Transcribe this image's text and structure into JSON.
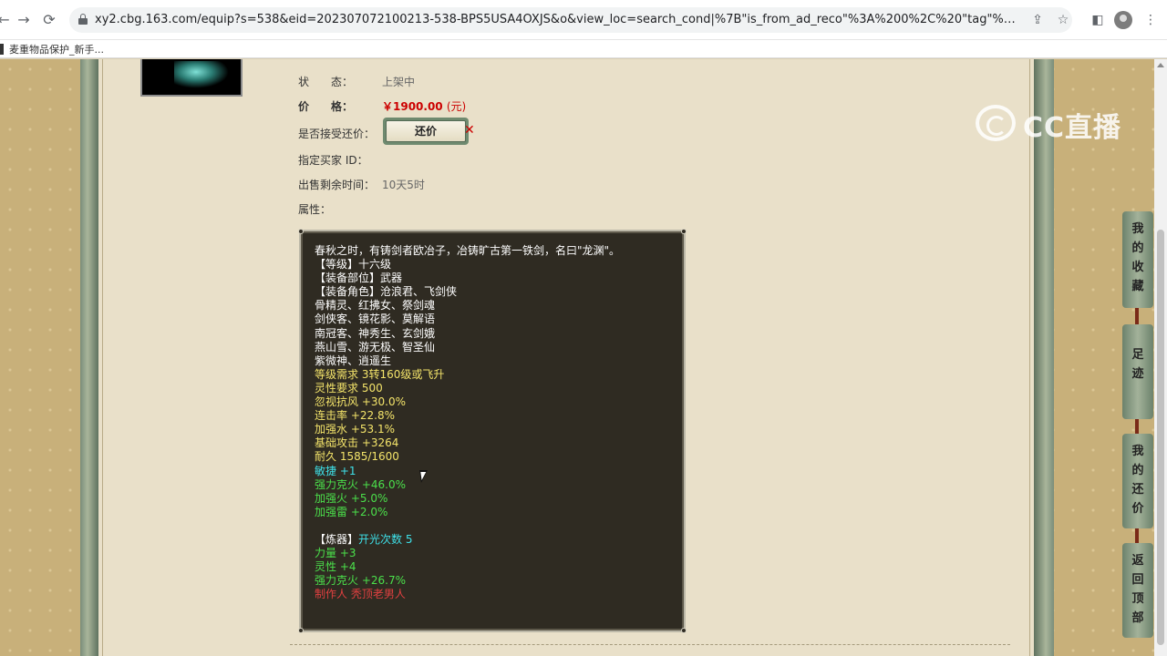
{
  "browser": {
    "url": "xy2.cbg.163.com/equip?s=538&eid=202307072100213-538-BPS5USA4OXJS&o&view_loc=search_cond|%7B\"is_from_ad_reco\"%3A%200%2C%20\"tag\"%3A%20\"user\"...",
    "bookmark_label": "麦重物品保护_新手..."
  },
  "item": {
    "status_label": "状　　态：",
    "status_value": "上架中",
    "price_label": "价　　格：",
    "price_value": "￥1900.00",
    "price_unit": "(元)",
    "counter_offer_label": "是否接受还价：",
    "counter_offer_button": "还价",
    "buyer_id_label": "指定买家 ID：",
    "remaining_label": "出售剩余时间：",
    "remaining_value": "10天5时",
    "attributes_label": "属性："
  },
  "attributes": {
    "lines": [
      {
        "text": "春秋之时，有铸剑者欧冶子，冶铸旷古第一铁剑，名曰\"龙渊\"。",
        "color": "white"
      },
      {
        "text": "【等级】十六级",
        "color": "white"
      },
      {
        "text": "【装备部位】武器",
        "color": "white"
      },
      {
        "text": "【装备角色】沧浪君、飞剑侠",
        "color": "white"
      },
      {
        "text": "骨精灵、红拂女、祭剑魂",
        "color": "white"
      },
      {
        "text": "剑侠客、镜花影、莫解语",
        "color": "white"
      },
      {
        "text": "南冠客、神秀生、玄剑娥",
        "color": "white"
      },
      {
        "text": "燕山雪、游无极、智圣仙",
        "color": "white"
      },
      {
        "text": "紫微神、逍遥生",
        "color": "white"
      },
      {
        "text": "等级需求 3转160级或飞升",
        "color": "yellow"
      },
      {
        "text": "灵性要求 500",
        "color": "yellow"
      },
      {
        "text": "忽视抗风 +30.0%",
        "color": "yellow"
      },
      {
        "text": "连击率 +22.8%",
        "color": "yellow"
      },
      {
        "text": "加强水 +53.1%",
        "color": "yellow"
      },
      {
        "text": "基础攻击 +3264",
        "color": "yellow"
      },
      {
        "text": "耐久 1585/1600",
        "color": "yellow"
      },
      {
        "text": "敏捷 +1",
        "color": "cyan"
      },
      {
        "text": "强力克火 +46.0%",
        "color": "green"
      },
      {
        "text": "加强火 +5.0%",
        "color": "green"
      },
      {
        "text": "加强雷 +2.0%",
        "color": "green"
      },
      {
        "text": "",
        "color": "white"
      },
      {
        "text": "【炼器】",
        "color": "white",
        "suffix": "开光次数 5",
        "suffix_color": "cyan"
      },
      {
        "text": "力量 +3",
        "color": "green"
      },
      {
        "text": "灵性 +4",
        "color": "green"
      },
      {
        "text": "强力克火 +26.7%",
        "color": "green"
      },
      {
        "text": "制作人 秃顶老男人",
        "color": "red"
      }
    ]
  },
  "watermark": {
    "text": "CC直播"
  },
  "side_menu": {
    "favorites": "我的收藏",
    "history": "足迹",
    "my_offers": "我的还价",
    "back_to_top": "返回顶部"
  },
  "colors": {
    "white": "#ffffff",
    "yellow": "#f4e46a",
    "cyan": "#3ee0e8",
    "green": "#4be04b",
    "red": "#e04040",
    "price_red": "#cc0000"
  }
}
